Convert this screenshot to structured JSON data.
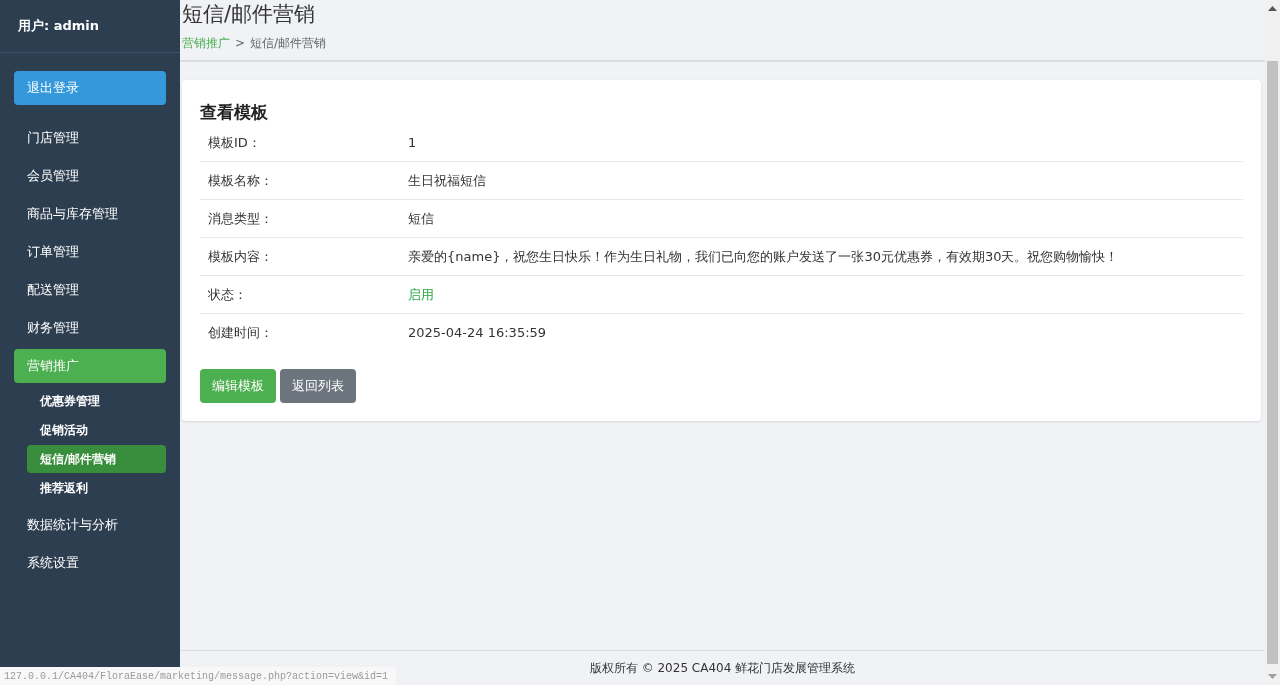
{
  "sidebar": {
    "user": "用户: admin",
    "logout": "退出登录",
    "items": [
      {
        "label": "门店管理",
        "selected": false
      },
      {
        "label": "会员管理",
        "selected": false
      },
      {
        "label": "商品与库存管理",
        "selected": false
      },
      {
        "label": "订单管理",
        "selected": false
      },
      {
        "label": "配送管理",
        "selected": false
      },
      {
        "label": "财务管理",
        "selected": false
      },
      {
        "label": "营销推广",
        "selected": true,
        "children": [
          {
            "label": "优惠券管理",
            "selected": false
          },
          {
            "label": "促销活动",
            "selected": false
          },
          {
            "label": "短信/邮件营销",
            "selected": true
          },
          {
            "label": "推荐返利",
            "selected": false
          }
        ]
      },
      {
        "label": "数据统计与分析",
        "selected": false
      },
      {
        "label": "系统设置",
        "selected": false
      }
    ]
  },
  "page": {
    "title": "短信/邮件营销",
    "breadcrumb": {
      "link": "营销推广",
      "separator": ">",
      "current": "短信/邮件营销"
    }
  },
  "card": {
    "title": "查看模板",
    "fields": [
      {
        "label": "模板ID：",
        "value": "1",
        "kind": "text"
      },
      {
        "label": "模板名称：",
        "value": "生日祝福短信",
        "kind": "text"
      },
      {
        "label": "消息类型：",
        "value": "短信",
        "kind": "text"
      },
      {
        "label": "模板内容：",
        "value": "亲爱的{name}，祝您生日快乐！作为生日礼物，我们已向您的账户发送了一张30元优惠券，有效期30天。祝您购物愉快！",
        "kind": "text"
      },
      {
        "label": "状态：",
        "value": "启用",
        "kind": "status"
      },
      {
        "label": "创建时间：",
        "value": "2025-04-24 16:35:59",
        "kind": "text"
      }
    ],
    "buttons": [
      {
        "label": "编辑模板",
        "kind": "primary"
      },
      {
        "label": "返回列表",
        "kind": "secondary"
      }
    ]
  },
  "footer": "版权所有 © 2025 CA404 鲜花门店发展管理系统",
  "status_bar": {
    "url": "127.0.0.1/CA404/FloraEase/marketing/message.php?action=view&id=1"
  }
}
